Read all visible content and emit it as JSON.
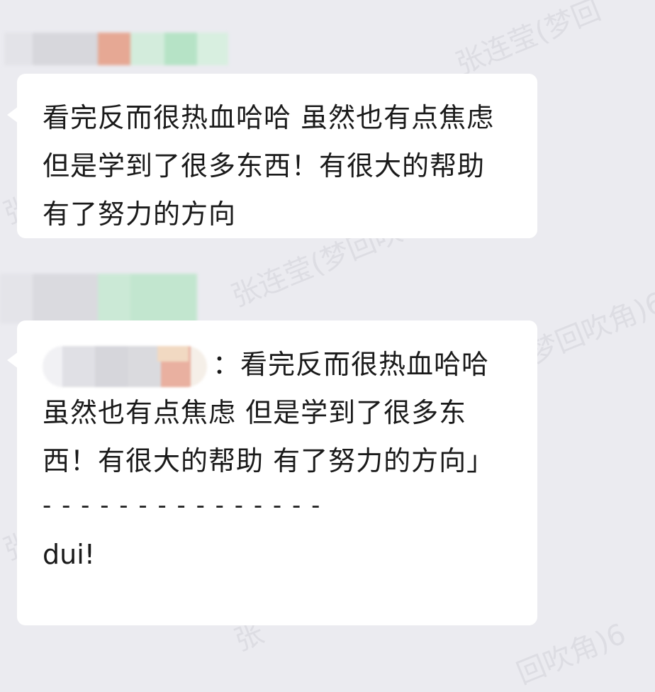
{
  "messages": [
    {
      "sender_redacted": true,
      "text": "看完反而很热血哈哈 虽然也有点焦虑 但是学到了很多东西！有很大的帮助 有了努力的方向"
    },
    {
      "sender_redacted": true,
      "quote": {
        "author_redacted": true,
        "separator": "：",
        "text": "看完反而很热血哈哈 虽然也有点焦虑 但是学到了很多东西！有很大的帮助 有了努力的方向」"
      },
      "divider": "- - - - - - - - - - - - - - -",
      "reply": "dui!"
    }
  ],
  "watermark": {
    "texts": [
      "张连莹(梦回",
      "张连莹(梦回吹",
      "梦回吹角)6",
      "张",
      "张",
      "张",
      "回吹角)6"
    ]
  },
  "colors": {
    "background": "#ebebf0",
    "bubble": "#ffffff",
    "text": "#1a1a1a"
  }
}
